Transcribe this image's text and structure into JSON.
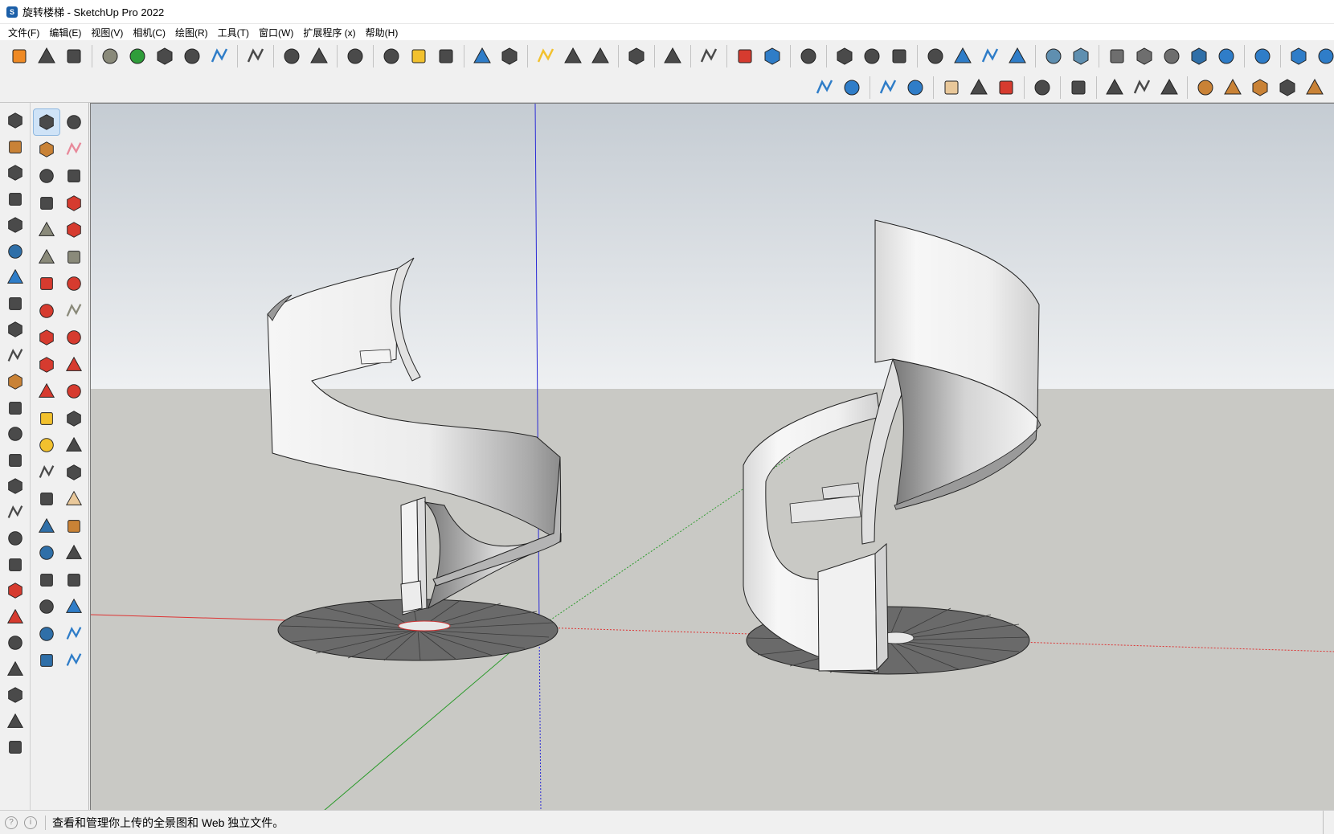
{
  "window": {
    "title": "旋转楼梯 - SketchUp Pro 2022",
    "icon": "sketchup-logo-icon"
  },
  "menu": [
    {
      "label": "文件(F)",
      "name": "menu-file"
    },
    {
      "label": "编辑(E)",
      "name": "menu-edit"
    },
    {
      "label": "视图(V)",
      "name": "menu-view"
    },
    {
      "label": "相机(C)",
      "name": "menu-camera"
    },
    {
      "label": "绘图(R)",
      "name": "menu-draw"
    },
    {
      "label": "工具(T)",
      "name": "menu-tools"
    },
    {
      "label": "窗口(W)",
      "name": "menu-window"
    },
    {
      "label": "扩展程序 (x)",
      "name": "menu-extensions"
    },
    {
      "label": "帮助(H)",
      "name": "menu-help"
    }
  ],
  "toolbar_main": [
    "sketchup-logo-icon",
    "refresh-icon",
    "arrows-exchange-icon",
    "sep",
    "add-circle-icon",
    "tree-icon",
    "color-swatches-icon",
    "checker-ball-icon",
    "cloud-upload-icon",
    "sep",
    "gear-settings-icon",
    "sep",
    "mail-icon",
    "info-icon",
    "sep",
    "user-icon",
    "sep",
    "list-icon",
    "lightbulb-icon",
    "contrast-icon",
    "sep",
    "rectangle-blue-icon",
    "crop-icon",
    "sep",
    "hexagon-yellow-icon",
    "hexagon-outline-icon",
    "target-icon",
    "sep",
    "components-icon",
    "sep",
    "erase-tag-icon",
    "sep",
    "style-swatch-icon",
    "sep",
    "trash-red-icon",
    "trash-blue-icon",
    "sep",
    "sync-icon",
    "sep",
    "checkbox-box-icon",
    "chain-link-icon",
    "stamp-icon",
    "sep",
    "axes-icon",
    "box-blue-icon",
    "house-icon",
    "house-alt-icon",
    "sep",
    "cube-solid-icon",
    "cube-outline-icon",
    "sep",
    "face-outline-icon",
    "face-plain-icon",
    "face-shaded-icon",
    "layers-dark-icon",
    "face-blue-icon",
    "sep",
    "section-cube-icon",
    "sep",
    "stairs-icon",
    "slope-icon"
  ],
  "toolbar_main_active": [
    44,
    45,
    46
  ],
  "toolbar_second": [
    "cloud-wave-icon",
    "cloud-share-icon",
    "sep",
    "cloud-check-icon",
    "cloud-list-icon",
    "sep",
    "expand-icon",
    "flower-icon",
    "rotate-check-icon",
    "sep",
    "chrome-icon",
    "sep",
    "steering-wheel-icon",
    "sep",
    "pencil-slant-icon",
    "measure-bracket-icon",
    "cursor-select-icon",
    "sep",
    "roof-icon",
    "window-frame-icon",
    "door-icon",
    "ruler-tool-icon",
    "paint-brush-icon"
  ],
  "left_bar1": [
    "pencil-select-icon",
    "door-frame-icon",
    "frame-icon",
    "railing-icon",
    "railing-alt-icon",
    "layers-stack-icon",
    "stairs-tool-icon",
    "cut-icon",
    "curve-arrow-icon",
    "corner-icon",
    "roof-tool-icon",
    "plane-icon",
    "lift-icon",
    "chain-icon",
    "bend-icon",
    "slice-icon",
    "fillet-icon",
    "ramp-icon",
    "push-icon",
    "arc-icon",
    "box-tool-icon",
    "grid-icon",
    "note-icon",
    "book-icon",
    "compass-icon"
  ],
  "left_bar2": [
    "select-arrow-icon",
    "orbit-3d-icon",
    "paint-bucket-icon",
    "eraser-icon",
    "component-box-icon",
    "tag-icon",
    "pencil-line-icon",
    "freehand-icon",
    "rectangle-tool-icon",
    "rotated-rect-icon",
    "circle-tool-icon",
    "polygon-tool-icon",
    "arc-tool-icon",
    "arc-2pt-icon",
    "arc-3pt-icon",
    "pie-tool-icon",
    "move-icon",
    "push-pull-icon",
    "rotate-icon",
    "follow-me-icon",
    "scale-icon",
    "offset-icon",
    "tape-measure-icon",
    "dimension-icon",
    "protractor-icon",
    "text-label-icon",
    "axes-tool-icon",
    "3d-text-icon",
    "orbit-icon",
    "pan-hand-icon",
    "zoom-icon",
    "zoom-window-icon",
    "zoom-extents-icon",
    "previous-view-icon",
    "position-camera-icon",
    "look-around-icon",
    "walk-icon",
    "section-plane-icon",
    "layers-tool-icon",
    "section-fill-icon",
    "layers-add-icon",
    "section-settings-icon"
  ],
  "left_bar2_active": [
    0
  ],
  "status": {
    "text": "查看和管理你上传的全景图和 Web 独立文件。",
    "right_char": "¥"
  }
}
